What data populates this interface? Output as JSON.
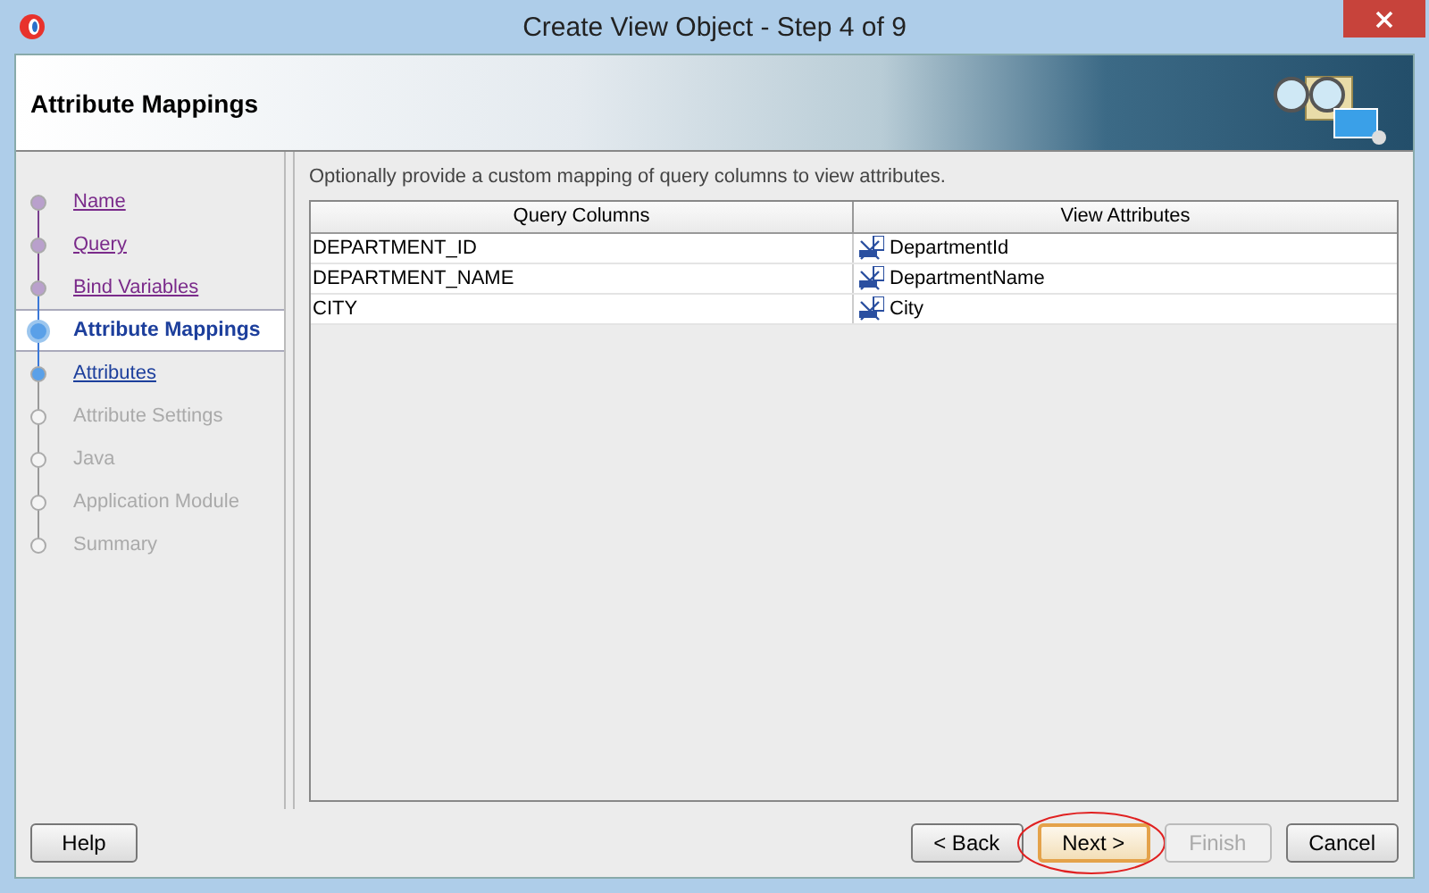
{
  "window": {
    "title": "Create View Object - Step 4 of 9"
  },
  "header": {
    "title": "Attribute Mappings"
  },
  "steps": [
    {
      "label": "Name",
      "kind": "visited"
    },
    {
      "label": "Query",
      "kind": "visited"
    },
    {
      "label": "Bind Variables",
      "kind": "visited"
    },
    {
      "label": "Attribute Mappings",
      "kind": "current"
    },
    {
      "label": "Attributes",
      "kind": "enabled"
    },
    {
      "label": "Attribute Settings",
      "kind": "disabled"
    },
    {
      "label": "Java",
      "kind": "disabled"
    },
    {
      "label": "Application Module",
      "kind": "disabled"
    },
    {
      "label": "Summary",
      "kind": "disabled"
    }
  ],
  "instruction": "Optionally provide a custom mapping of query columns to view attributes.",
  "table": {
    "columns": [
      "Query Columns",
      "View Attributes"
    ],
    "rows": [
      {
        "query_column": "DEPARTMENT_ID",
        "view_attribute": "DepartmentId"
      },
      {
        "query_column": "DEPARTMENT_NAME",
        "view_attribute": "DepartmentName"
      },
      {
        "query_column": "CITY",
        "view_attribute": "City"
      }
    ]
  },
  "help_button": {
    "label": "Help"
  },
  "buttons": [
    {
      "label": "< Back",
      "disabled": false,
      "highlighted": false
    },
    {
      "label": "Next >",
      "disabled": false,
      "highlighted": true
    },
    {
      "label": "Finish",
      "disabled": true,
      "highlighted": false
    },
    {
      "label": "Cancel",
      "disabled": false,
      "highlighted": false
    }
  ]
}
